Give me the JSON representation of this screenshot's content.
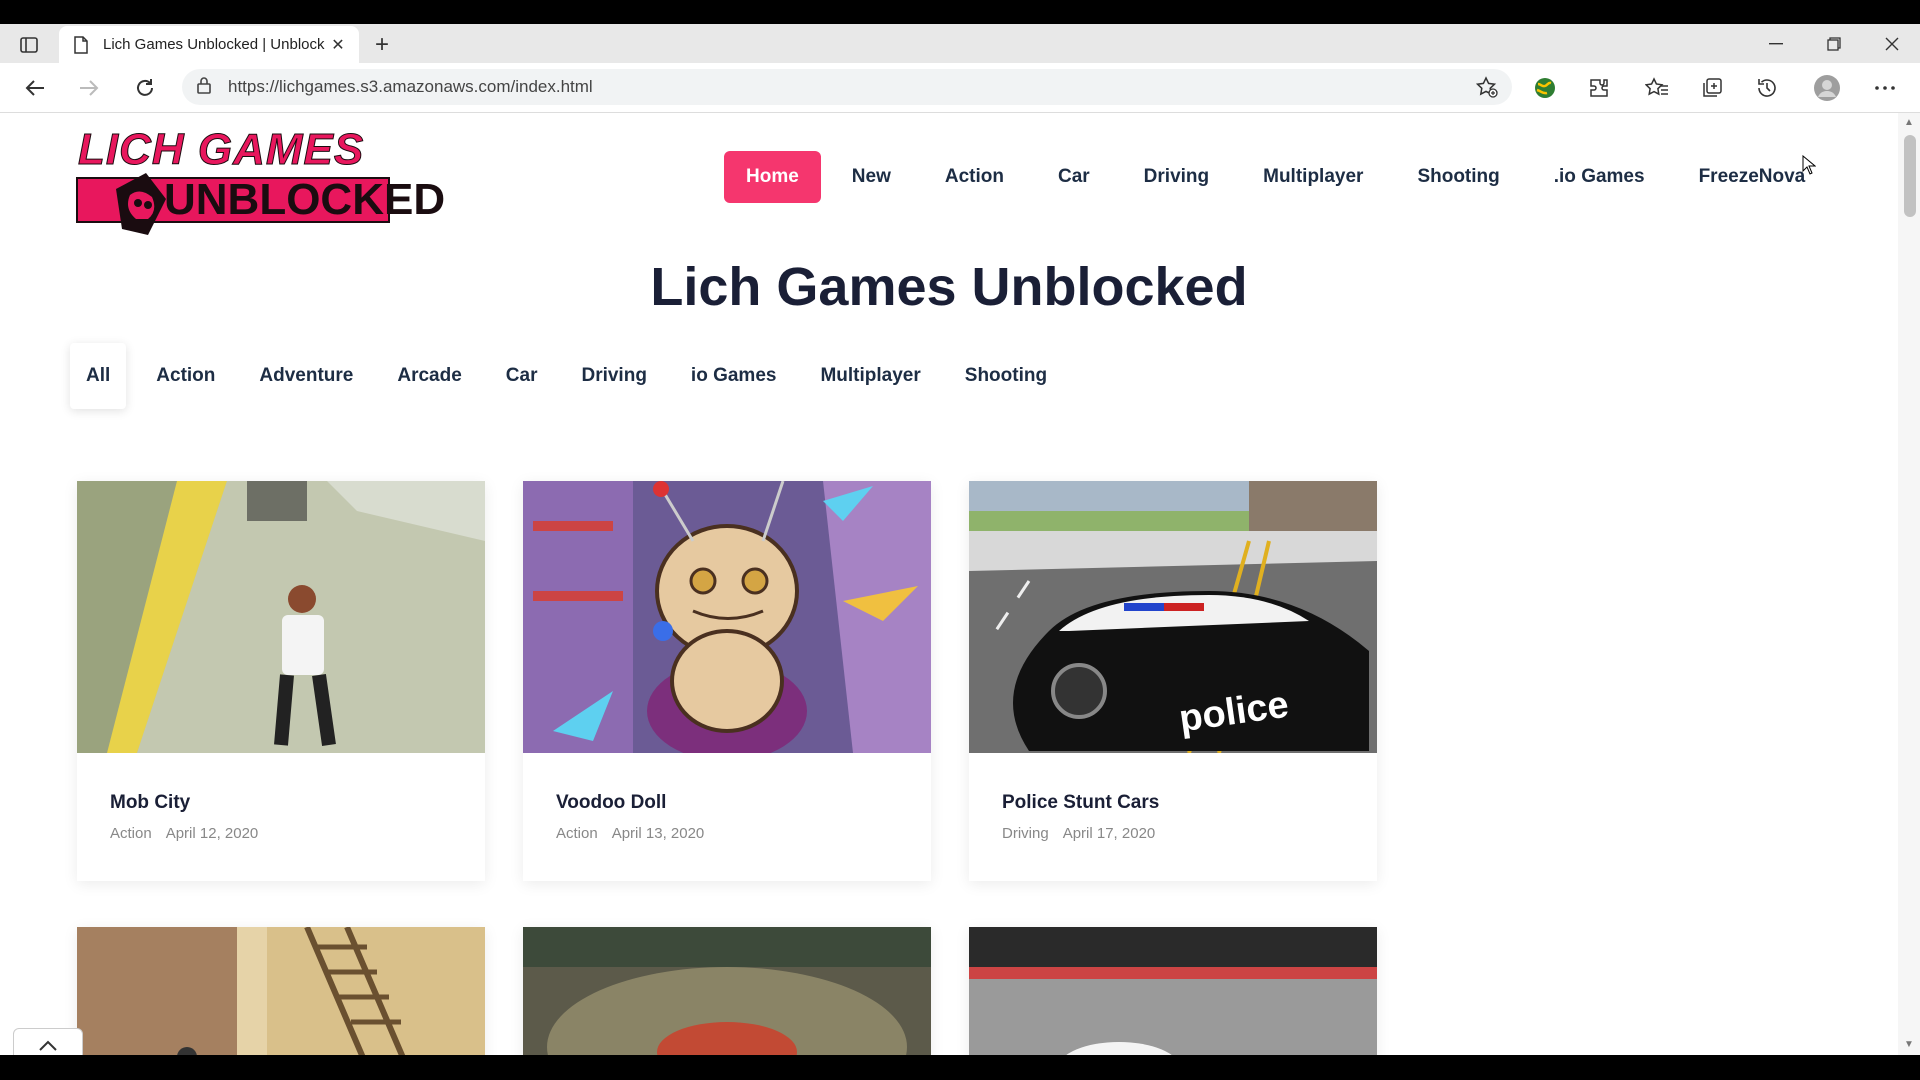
{
  "browser": {
    "tab_title": "Lich Games Unblocked | Unblock",
    "url": "https://lichgames.s3.amazonaws.com/index.html",
    "new_tab_symbol": "+",
    "close_tab_symbol": "✕"
  },
  "site": {
    "logo_line1": "LICH GAMES",
    "logo_line2": "UNBLOCKED",
    "nav": [
      {
        "label": "Home",
        "active": true
      },
      {
        "label": "New"
      },
      {
        "label": "Action"
      },
      {
        "label": "Car"
      },
      {
        "label": "Driving"
      },
      {
        "label": "Multiplayer"
      },
      {
        "label": "Shooting"
      },
      {
        "label": ".io Games"
      },
      {
        "label": "FreezeNova"
      }
    ],
    "title": "Lich Games Unblocked",
    "filters": [
      "All",
      "Action",
      "Adventure",
      "Arcade",
      "Car",
      "Driving",
      "io Games",
      "Multiplayer",
      "Shooting"
    ],
    "games": [
      {
        "title": "Mob City",
        "category": "Action",
        "date": "April 12, 2020"
      },
      {
        "title": "Voodoo Doll",
        "category": "Action",
        "date": "April 13, 2020"
      },
      {
        "title": "Police Stunt Cars",
        "category": "Driving",
        "date": "April 17, 2020"
      }
    ],
    "police_text": "police"
  },
  "colors": {
    "accent": "#f5366e",
    "heading": "#1a1f36"
  }
}
